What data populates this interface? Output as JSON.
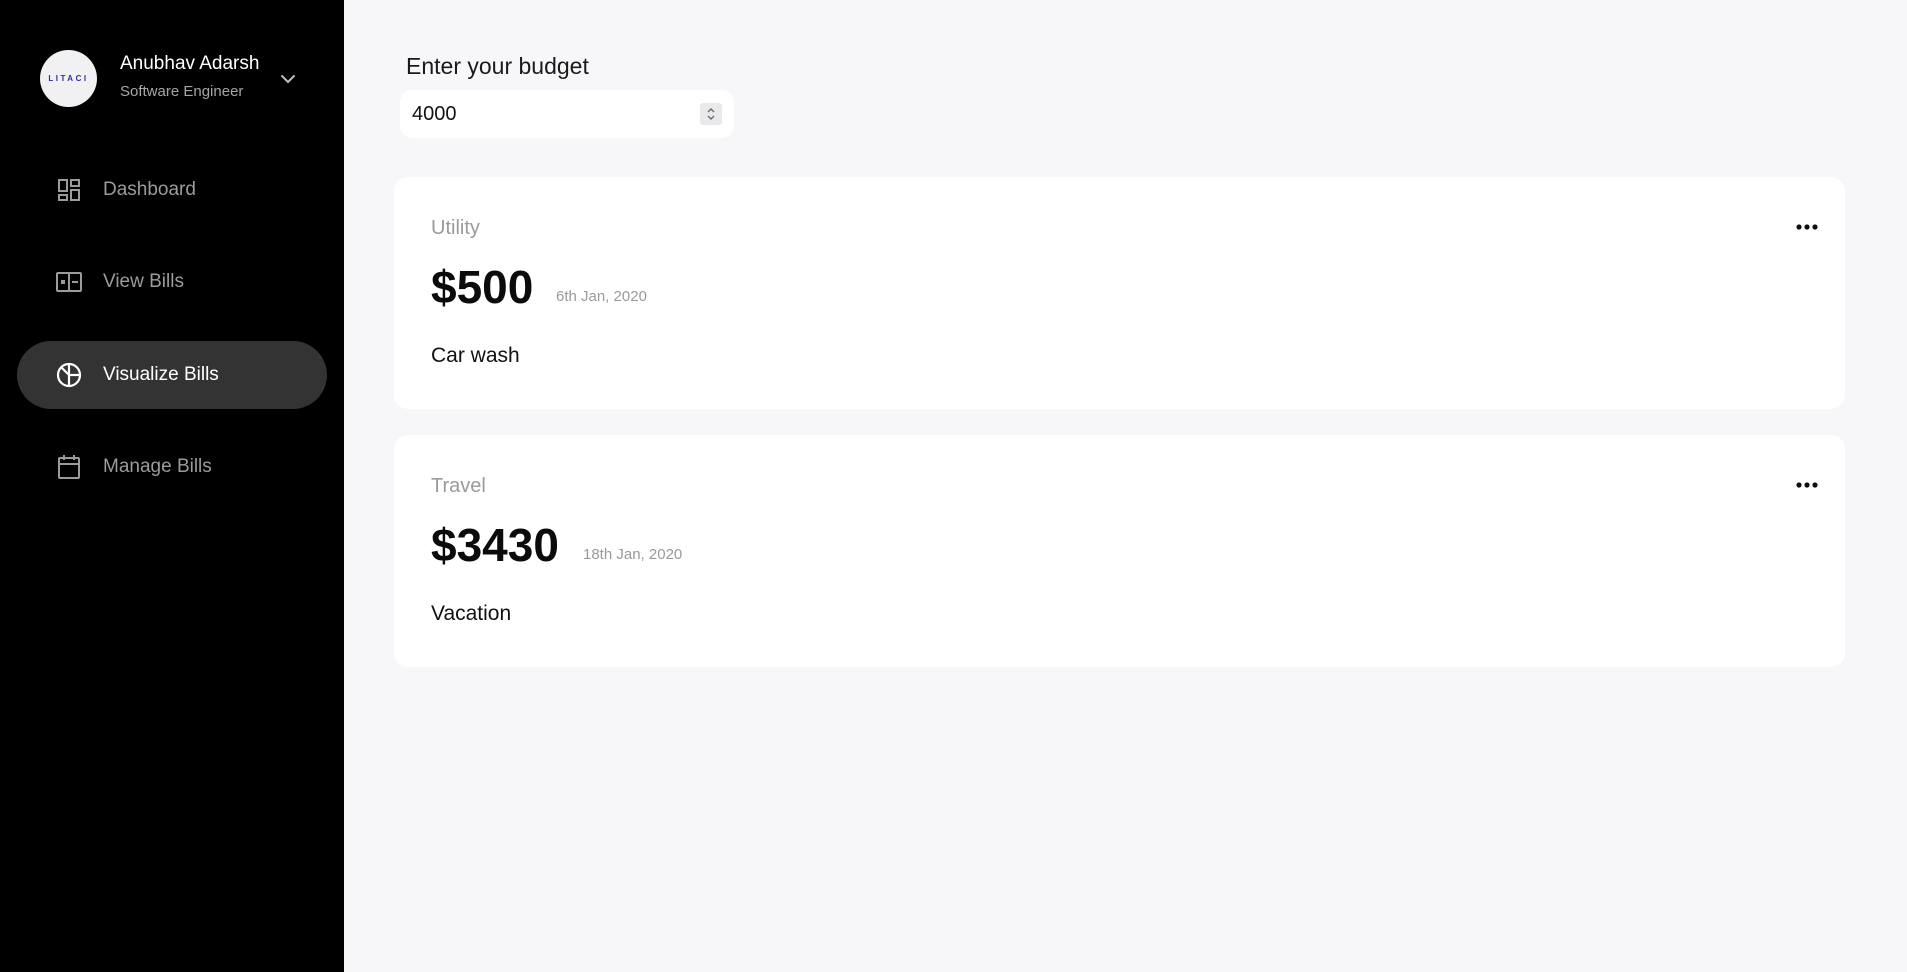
{
  "profile": {
    "avatar_text": "LITACI",
    "name": "Anubhav Adarsh",
    "role": "Software Engineer",
    "toggle_icon": "chevron-down-icon"
  },
  "nav": {
    "items": [
      {
        "label": "Dashboard",
        "icon": "dashboard-icon",
        "active": false
      },
      {
        "label": "View Bills",
        "icon": "bills-card-icon",
        "active": false
      },
      {
        "label": "Visualize Bills",
        "icon": "pie-chart-icon",
        "active": true
      },
      {
        "label": "Manage Bills",
        "icon": "calendar-icon",
        "active": false
      }
    ]
  },
  "budget": {
    "label": "Enter your budget",
    "value": "4000"
  },
  "bills": [
    {
      "category": "Utility",
      "amount": "$500",
      "date": "6th Jan, 2020",
      "description": "Car wash"
    },
    {
      "category": "Travel",
      "amount": "$3430",
      "date": "18th Jan, 2020",
      "description": "Vacation"
    }
  ],
  "colors": {
    "sidebar_bg": "#000000",
    "active_nav_bg": "#333333",
    "page_bg": "#f7f7f9",
    "card_bg": "#ffffff",
    "muted_text": "#9a9a9a",
    "avatar_text": "#2e2fa6"
  }
}
